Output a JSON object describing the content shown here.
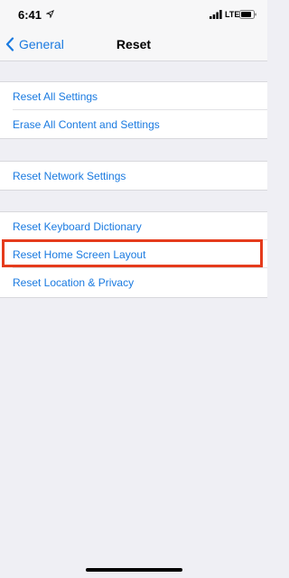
{
  "status_bar": {
    "time": "6:41",
    "network": "LTE"
  },
  "nav": {
    "back_label": "General",
    "title": "Reset"
  },
  "groups": [
    {
      "items": [
        {
          "label": "Reset All Settings"
        },
        {
          "label": "Erase All Content and Settings"
        }
      ]
    },
    {
      "items": [
        {
          "label": "Reset Network Settings"
        }
      ]
    },
    {
      "items": [
        {
          "label": "Reset Keyboard Dictionary"
        },
        {
          "label": "Reset Home Screen Layout"
        },
        {
          "label": "Reset Location & Privacy"
        }
      ]
    }
  ],
  "colors": {
    "accent": "#1a7ae0",
    "highlight": "#e53b1c",
    "background": "#efeff4"
  },
  "icons": [
    "location-arrow-icon",
    "cellular-signal-icon",
    "battery-icon",
    "chevron-left-icon"
  ]
}
